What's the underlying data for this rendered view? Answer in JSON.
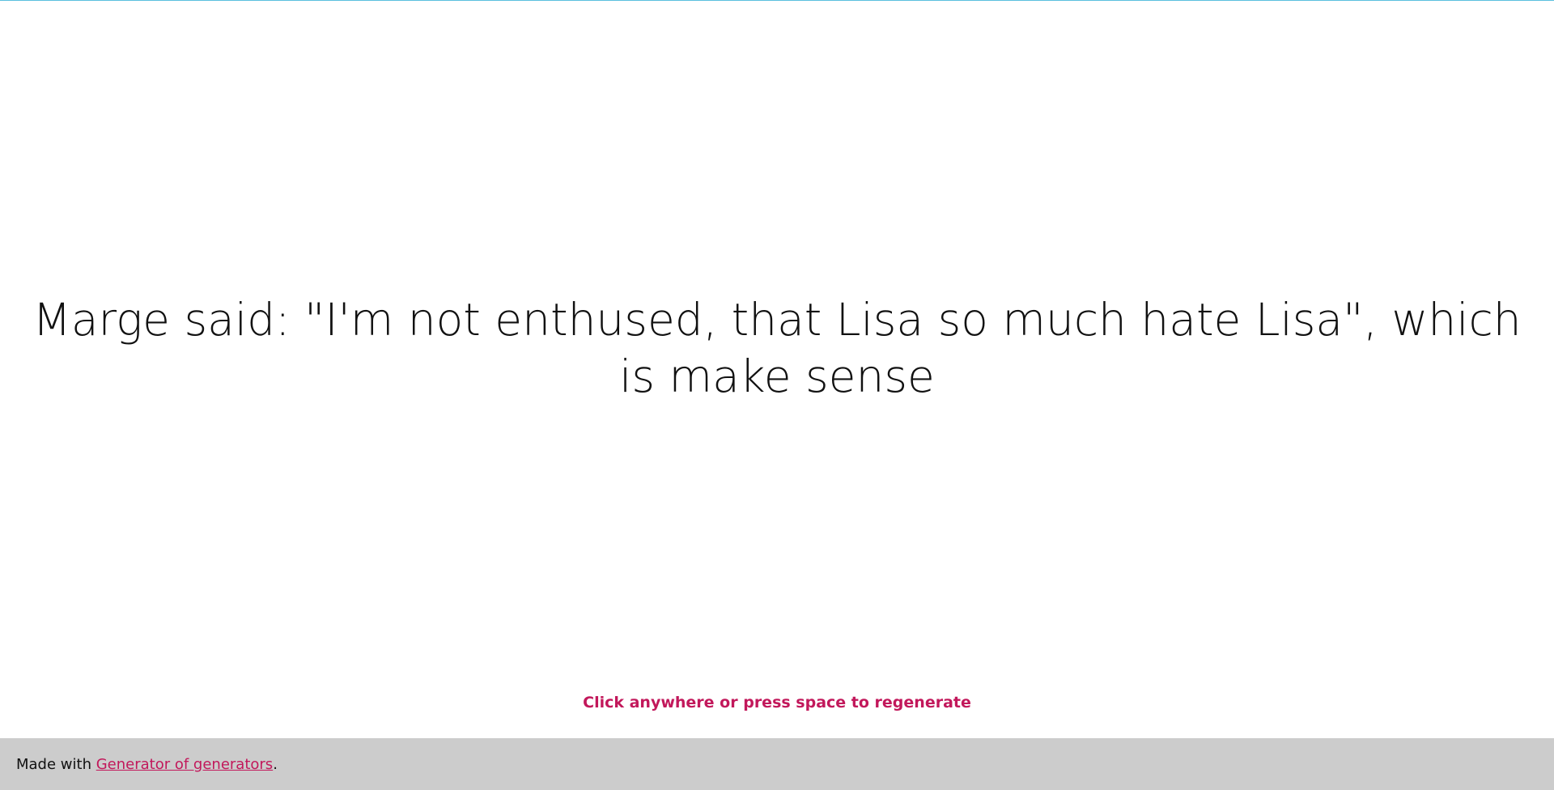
{
  "main": {
    "sentence": "Marge said: \"I'm not enthused, that Lisa so much hate Lisa\", which is make sense"
  },
  "hint": {
    "text": "Click anywhere or press space to regenerate"
  },
  "footer": {
    "prefix": "Made with ",
    "link_label": "Generator of generators",
    "suffix": "."
  },
  "colors": {
    "accent": "#c2185b",
    "footer_bg": "#cccccc",
    "top_border": "#5bc0de"
  }
}
